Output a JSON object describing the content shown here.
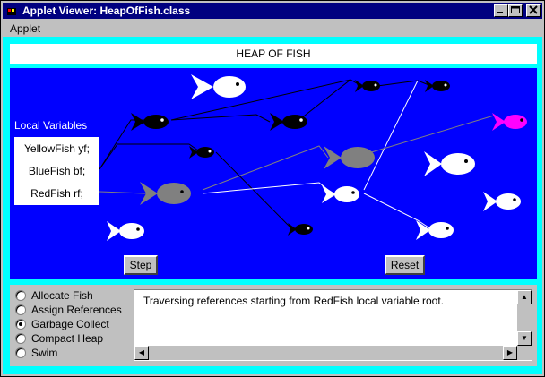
{
  "window": {
    "title": "Applet Viewer: HeapOfFish.class"
  },
  "menubar": {
    "applet": "Applet"
  },
  "header": {
    "title": "HEAP OF FISH"
  },
  "local_vars": {
    "heading": "Local Variables",
    "items": [
      "YellowFish yf;",
      "BlueFish bf;",
      "RedFish rf;"
    ]
  },
  "buttons": {
    "step": "Step",
    "reset": "Reset"
  },
  "modes": [
    {
      "label": "Allocate Fish",
      "selected": false
    },
    {
      "label": "Assign References",
      "selected": false
    },
    {
      "label": "Garbage Collect",
      "selected": true
    },
    {
      "label": "Compact Heap",
      "selected": false
    },
    {
      "label": "Swim",
      "selected": false
    }
  ],
  "message": "Traversing references starting from RedFish local variable root.",
  "colors": {
    "title_bar": "#000080",
    "canvas": "#0000ff",
    "frame": "#00ffff",
    "fish_black": "#000000",
    "fish_white": "#ffffff",
    "fish_gray": "#808080",
    "fish_magenta": "#ff00ff"
  }
}
